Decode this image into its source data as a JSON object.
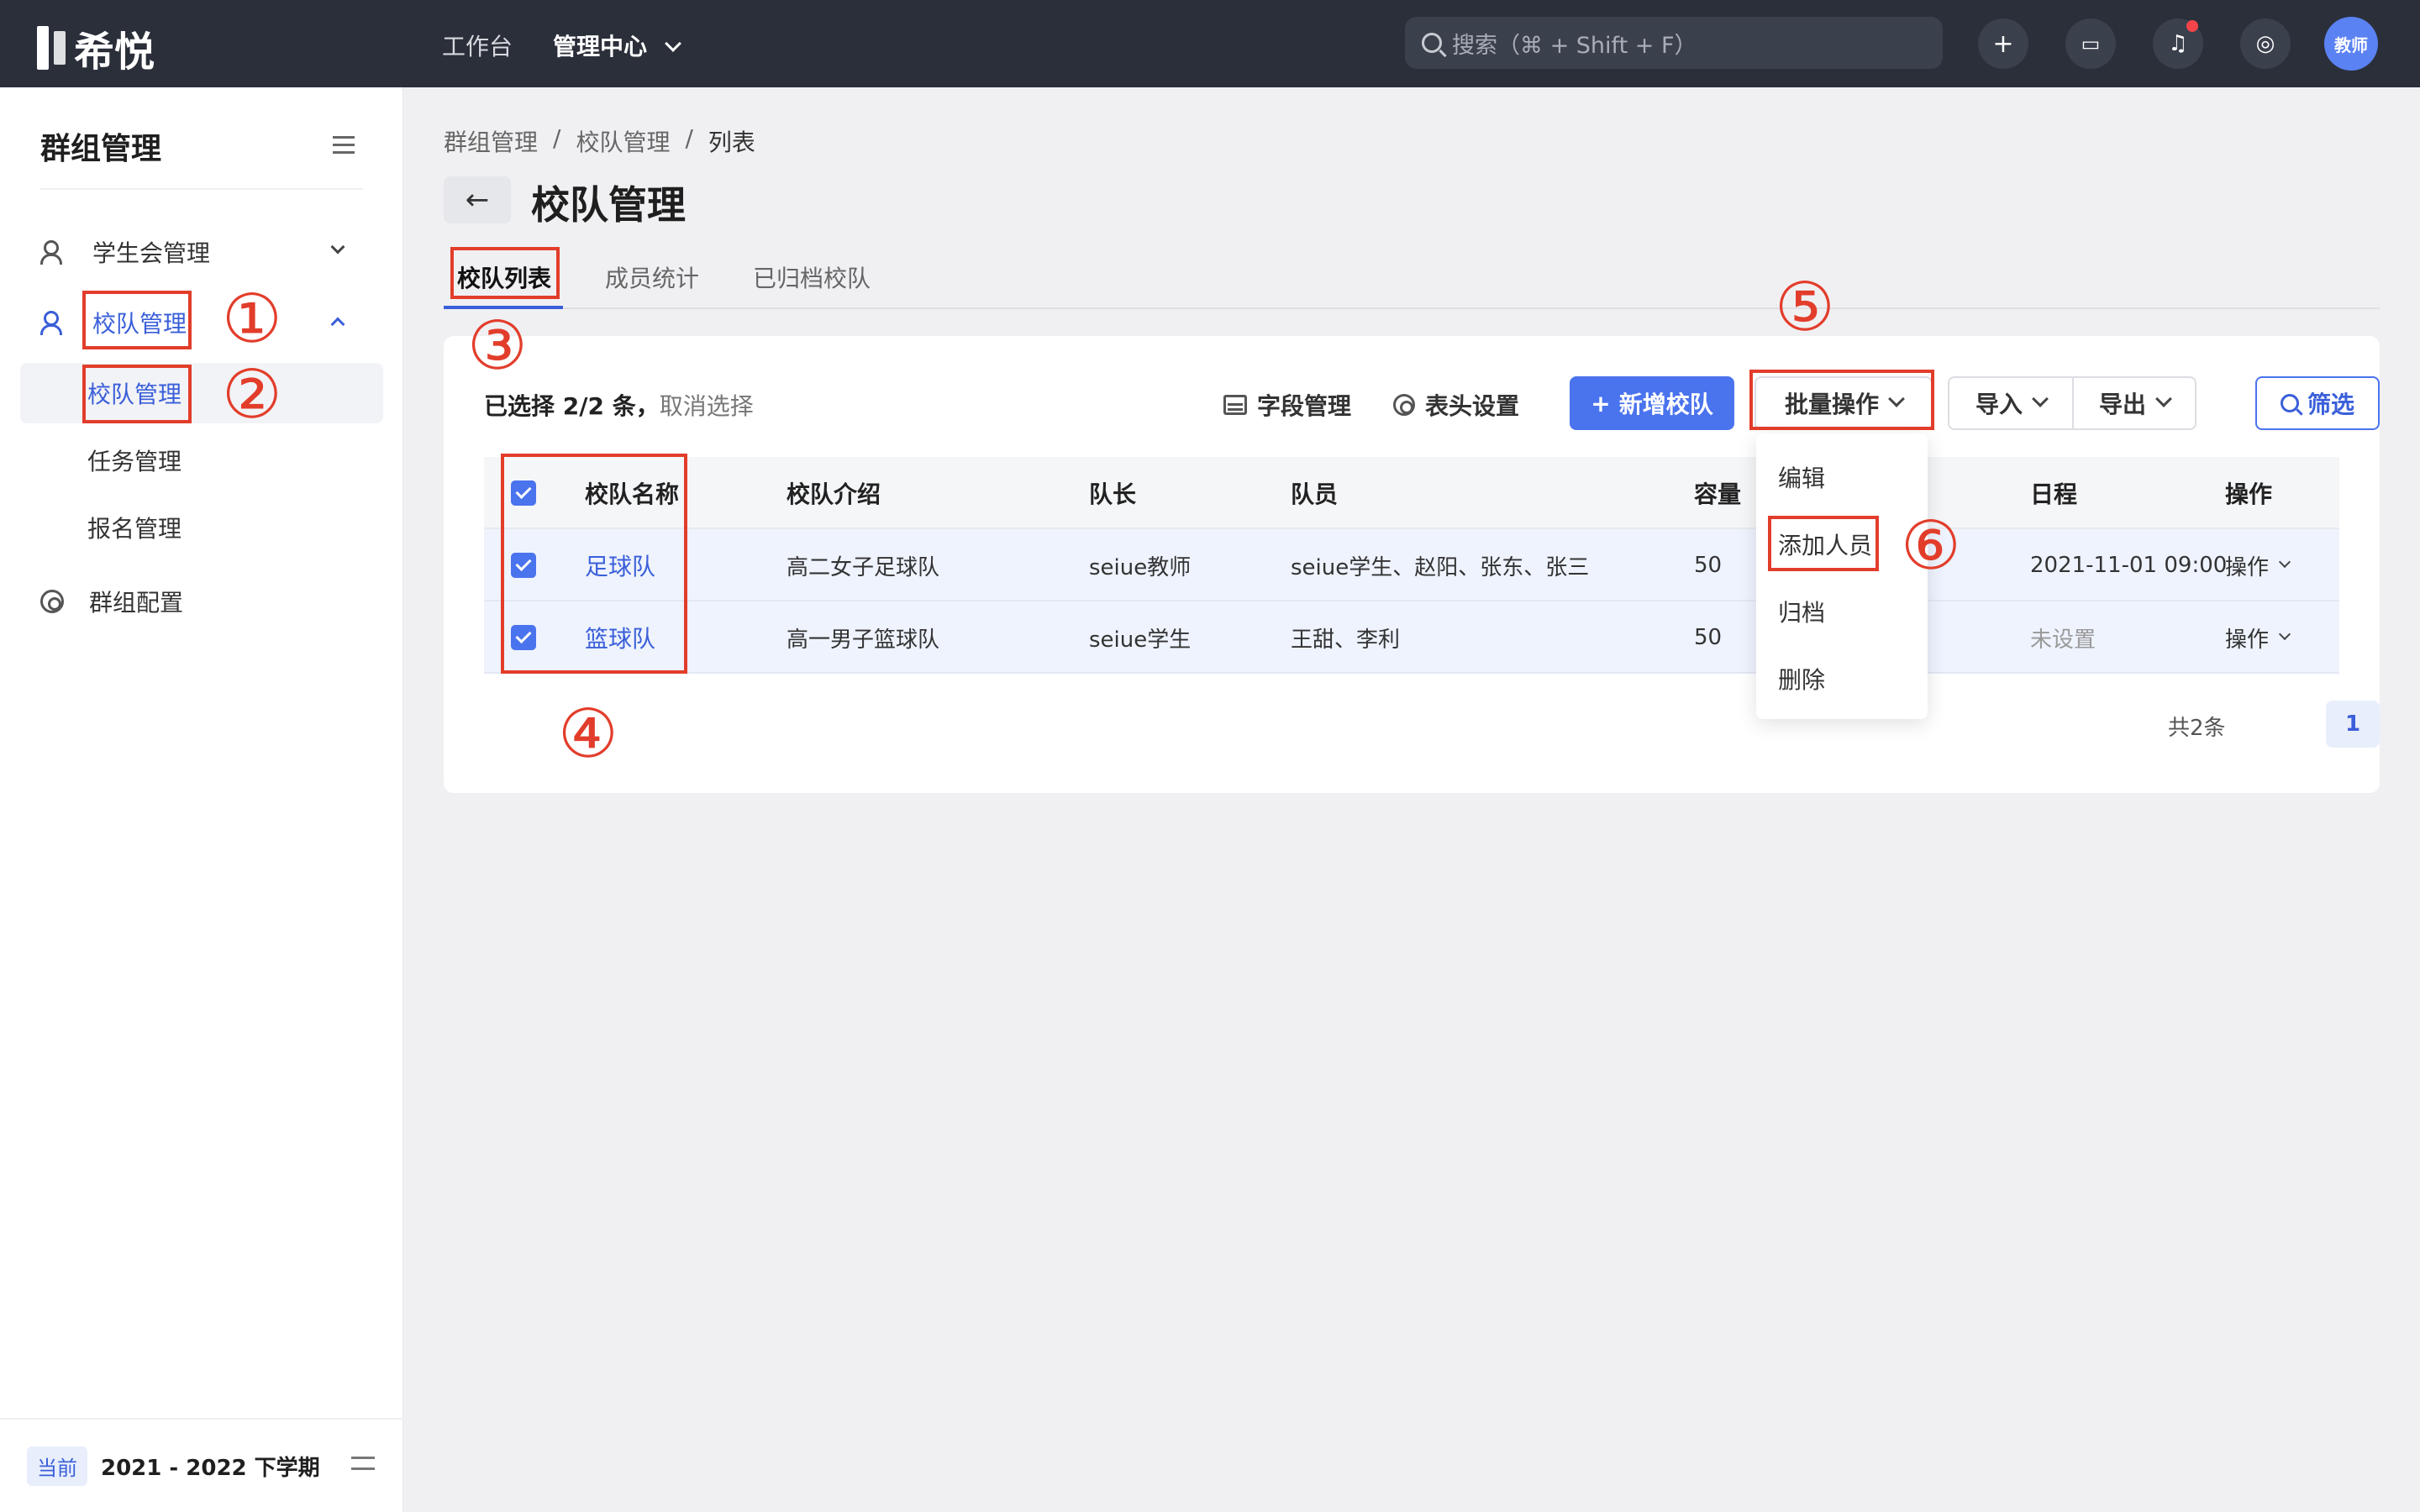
{
  "app": {
    "logo_text": "希悦"
  },
  "topbar": {
    "nav_workbench": "工作台",
    "nav_admin": "管理中心",
    "search_placeholder": "搜索（⌘ + Shift + F）",
    "avatar_label": "教师"
  },
  "sidebar": {
    "title": "群组管理",
    "items": [
      {
        "label": "学生会管理"
      },
      {
        "label": "校队管理"
      },
      {
        "label": "校队管理"
      },
      {
        "label": "任务管理"
      },
      {
        "label": "报名管理"
      },
      {
        "label": "群组配置"
      }
    ],
    "footer": {
      "badge": "当前",
      "term": "2021 - 2022 下学期"
    }
  },
  "main": {
    "breadcrumb": [
      "群组管理",
      "/",
      "校队管理",
      "/",
      "列表"
    ],
    "title": "校队管理",
    "tabs": [
      "校队列表",
      "成员统计",
      "已归档校队"
    ],
    "selection": {
      "text": "已选择 2/2 条，",
      "cancel": "取消选择"
    },
    "toolbar": {
      "fields": "字段管理",
      "header_settings": "表头设置",
      "add_team": "新增校队",
      "batch": "批量操作",
      "import": "导入",
      "export": "导出",
      "filter": "筛选"
    },
    "table": {
      "headers": [
        "校队名称",
        "校队介绍",
        "队长",
        "队员",
        "容量",
        "日程",
        "操作"
      ],
      "rows": [
        {
          "name": "足球队",
          "intro": "高二女子足球队",
          "captain": "seiue教师",
          "members": "seiue学生、赵阳、张东、张三",
          "capacity": "50",
          "schedule": "2021-11-01 09:00",
          "op": "操作"
        },
        {
          "name": "篮球队",
          "intro": "高一男子篮球队",
          "captain": "seiue学生",
          "members": "王甜、李利",
          "capacity": "50",
          "schedule": "未设置",
          "op": "操作"
        }
      ]
    },
    "pagination": {
      "total": "共2条",
      "page": "1"
    },
    "batch_menu": [
      "编辑",
      "添加人员",
      "归档",
      "删除"
    ]
  },
  "annotations": [
    "①",
    "②",
    "③",
    "④",
    "⑤",
    "⑥"
  ],
  "colors": {
    "accent": "#4a73ee",
    "annotation": "#e23d2b",
    "topbar": "#2b2f3a"
  }
}
